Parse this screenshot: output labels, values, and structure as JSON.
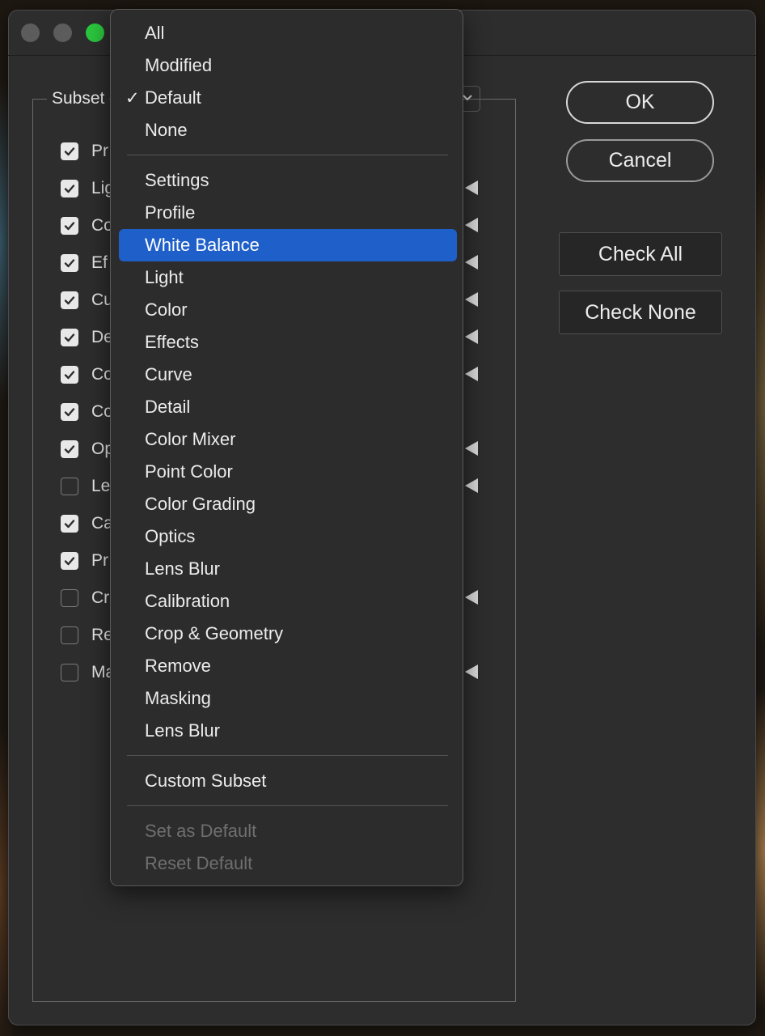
{
  "window": {
    "group_label": "Subset",
    "checkboxes": [
      {
        "label": "Pr",
        "checked": true
      },
      {
        "label": "Lig",
        "checked": true
      },
      {
        "label": "Co",
        "checked": true
      },
      {
        "label": "Ef",
        "checked": true
      },
      {
        "label": "Cu",
        "checked": true
      },
      {
        "label": "De",
        "checked": true
      },
      {
        "label": "Co",
        "checked": true
      },
      {
        "label": "Co",
        "checked": true
      },
      {
        "label": "Op",
        "checked": true
      },
      {
        "label": "Le",
        "checked": false
      },
      {
        "label": "Ca",
        "checked": true
      },
      {
        "label": "Pr",
        "checked": true
      },
      {
        "label": "Cr",
        "checked": false
      },
      {
        "label": "Re",
        "checked": false
      },
      {
        "label": "Ma",
        "checked": false
      }
    ],
    "buttons": {
      "ok": "OK",
      "cancel": "Cancel",
      "check_all": "Check All",
      "check_none": "Check None"
    }
  },
  "menu": {
    "items": [
      {
        "label": "All"
      },
      {
        "label": "Modified"
      },
      {
        "label": "Default",
        "checked": true
      },
      {
        "label": "None"
      },
      {
        "label": "Settings"
      },
      {
        "label": "Profile"
      },
      {
        "label": "White Balance",
        "highlighted": true
      },
      {
        "label": "Light"
      },
      {
        "label": "Color"
      },
      {
        "label": "Effects"
      },
      {
        "label": "Curve"
      },
      {
        "label": "Detail"
      },
      {
        "label": "Color Mixer"
      },
      {
        "label": "Point Color"
      },
      {
        "label": "Color Grading"
      },
      {
        "label": "Optics"
      },
      {
        "label": "Lens Blur"
      },
      {
        "label": "Calibration"
      },
      {
        "label": "Crop & Geometry"
      },
      {
        "label": "Remove"
      },
      {
        "label": "Masking"
      },
      {
        "label": "Lens Blur"
      },
      {
        "label": "Custom Subset"
      },
      {
        "label": "Set as Default",
        "disabled": true
      },
      {
        "label": "Reset Default",
        "disabled": true
      }
    ],
    "check_mark": "✓"
  },
  "colors": {
    "highlight": "#1f5fc9",
    "window_bg": "#2d2d2d",
    "zoom_button": "#2ac63e"
  }
}
